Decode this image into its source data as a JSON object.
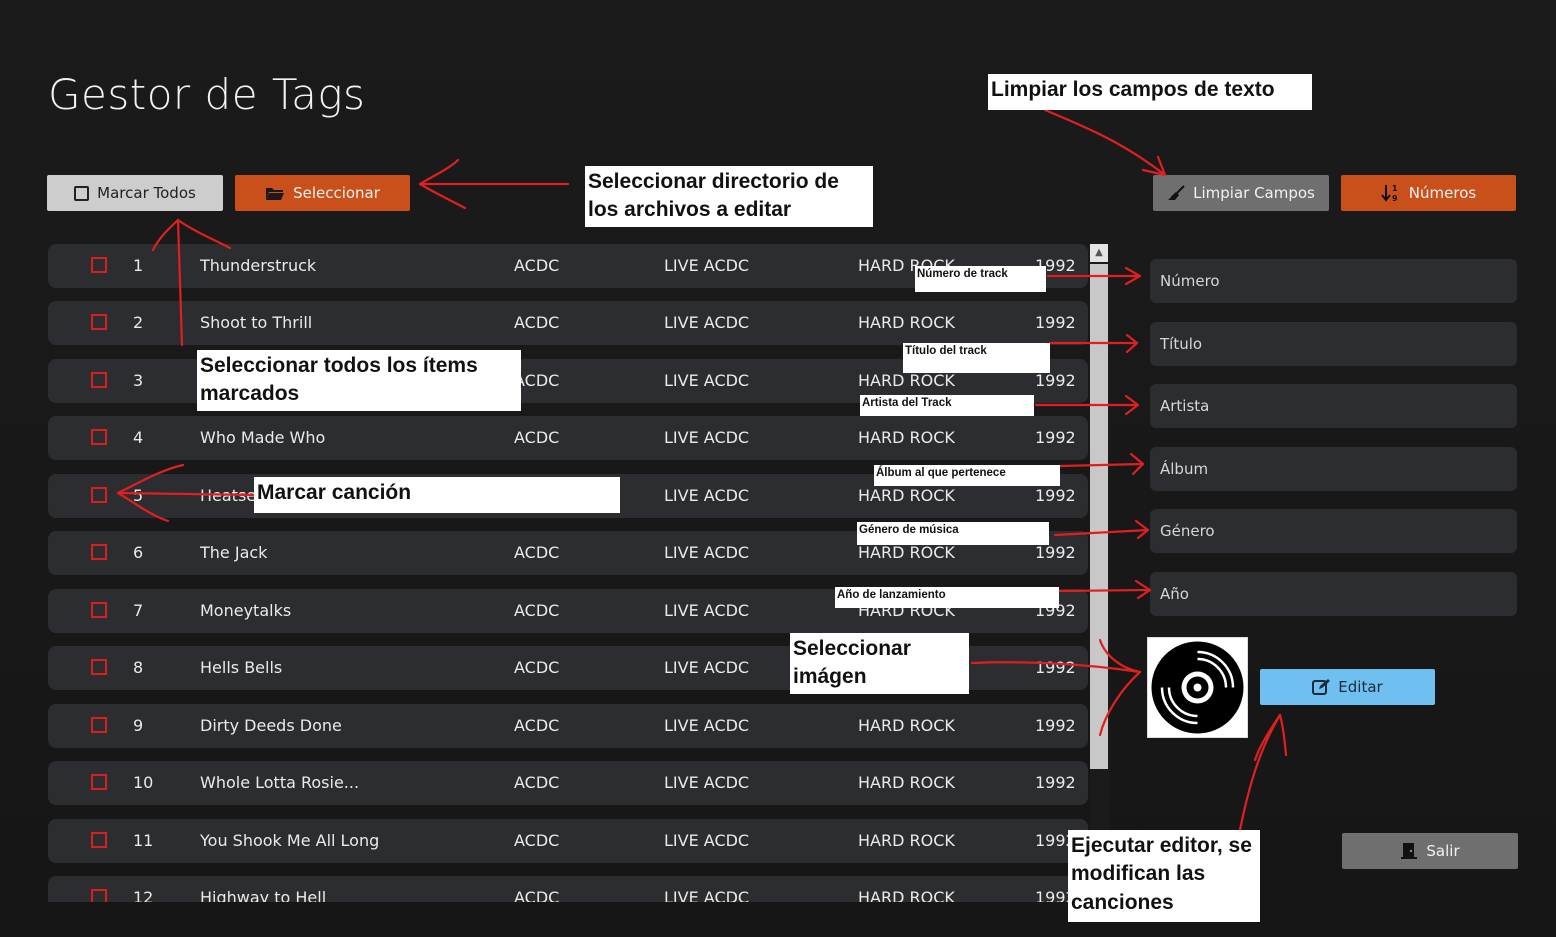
{
  "app": {
    "title": "Gestor de Tags"
  },
  "toolbar": {
    "mark_all": "Marcar Todos",
    "select": "Seleccionar",
    "clear": "Limpiar Campos",
    "numbers": "Números"
  },
  "songs": [
    {
      "n": "1",
      "title": "Thunderstruck",
      "artist": "ACDC",
      "album": "LIVE ACDC",
      "genre": "HARD ROCK",
      "year": "1992"
    },
    {
      "n": "2",
      "title": "Shoot to Thrill",
      "artist": "ACDC",
      "album": "LIVE ACDC",
      "genre": "HARD ROCK",
      "year": "1992"
    },
    {
      "n": "3",
      "title": "",
      "artist": "ACDC",
      "album": "LIVE ACDC",
      "genre": "HARD ROCK",
      "year": "1992"
    },
    {
      "n": "4",
      "title": "Who Made Who",
      "artist": "ACDC",
      "album": "LIVE ACDC",
      "genre": "HARD ROCK",
      "year": "1992"
    },
    {
      "n": "5",
      "title": "Heatsee",
      "artist": "",
      "album": "LIVE ACDC",
      "genre": "HARD ROCK",
      "year": "1992"
    },
    {
      "n": "6",
      "title": "The Jack",
      "artist": "ACDC",
      "album": "LIVE ACDC",
      "genre": "HARD ROCK",
      "year": "1992"
    },
    {
      "n": "7",
      "title": "Moneytalks",
      "artist": "ACDC",
      "album": "LIVE ACDC",
      "genre": "HARD ROCK",
      "year": "1992"
    },
    {
      "n": "8",
      "title": "Hells Bells",
      "artist": "ACDC",
      "album": "LIVE ACDC",
      "genre": "",
      "year": "1992"
    },
    {
      "n": "9",
      "title": "Dirty Deeds Done",
      "artist": "ACDC",
      "album": "LIVE ACDC",
      "genre": "HARD ROCK",
      "year": "1992"
    },
    {
      "n": "10",
      "title": "Whole Lotta Rosie...",
      "artist": "ACDC",
      "album": "LIVE ACDC",
      "genre": "HARD ROCK",
      "year": "1992"
    },
    {
      "n": "11",
      "title": "You Shook Me All Long",
      "artist": "ACDC",
      "album": "LIVE ACDC",
      "genre": "HARD ROCK",
      "year": "1992"
    },
    {
      "n": "12",
      "title": "Highway to Hell",
      "artist": "ACDC",
      "album": "LIVE ACDC",
      "genre": "HARD ROCK",
      "year": "1992"
    }
  ],
  "fields": {
    "number": "Número",
    "title": "Título",
    "artist": "Artista",
    "album": "Álbum",
    "genre": "Género",
    "year": "Año"
  },
  "actions": {
    "edit": "Editar",
    "exit": "Salir"
  },
  "annotations": {
    "clear_fields": "Limpiar los campos de texto",
    "select_dir": "Seleccionar directorio de los archivos a editar",
    "select_all": "Seleccionar todos los ítems marcados",
    "mark_song": "Marcar canción",
    "track_number": "Número de track",
    "track_title": "Título del track",
    "track_artist": "Artista del Track",
    "track_album": "Álbum al que pertenece",
    "genre": "Género de música",
    "year": "Año de lanzamiento",
    "select_image": "Seleccionar imágen",
    "run_editor": "Ejecutar editor, se modifican las canciones"
  },
  "colors": {
    "accent": "#c9501b",
    "edit": "#6fbff0",
    "checkbox": "#d81f1f",
    "row": "#2b2d30",
    "annotation": "#e02020"
  },
  "icons": [
    "checkbox-icon",
    "folder-icon",
    "broom-icon",
    "sort-numbers-icon",
    "edit-icon",
    "exit-icon",
    "vinyl-disc-icon"
  ]
}
